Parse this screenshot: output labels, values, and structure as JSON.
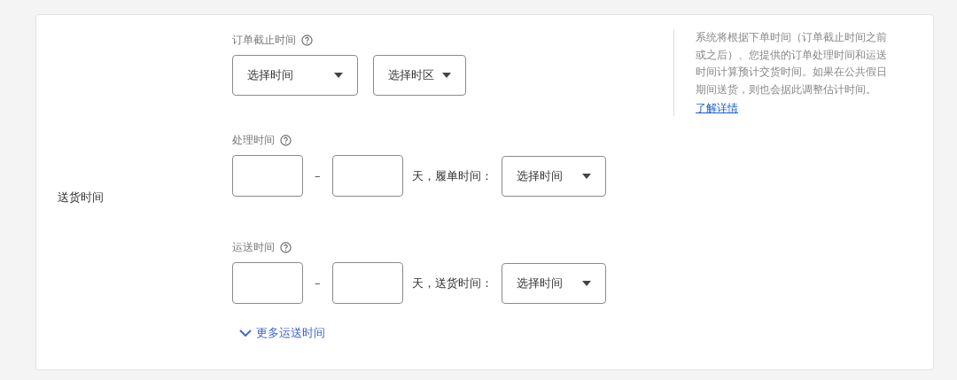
{
  "row_label": "送货时间",
  "cutoff": {
    "label": "订单截止时间",
    "time_select": "选择时间",
    "zone_select": "选择时区"
  },
  "processing": {
    "label": "处理时间",
    "separator": "–",
    "unit_text": "天，履单时间：",
    "time_select": "选择时间"
  },
  "transit": {
    "label": "运送时间",
    "separator": "–",
    "unit_text": "天，送货时间：",
    "time_select": "选择时间"
  },
  "more_link": "更多运送时间",
  "help": {
    "text": "系统将根据下单时间（订单截止时间之前或之后）、您提供的订单处理时间和运送时间计算预计交货时间。如果在公共假日期间送货，则也会据此调整估计时间。",
    "link": "了解详情"
  }
}
